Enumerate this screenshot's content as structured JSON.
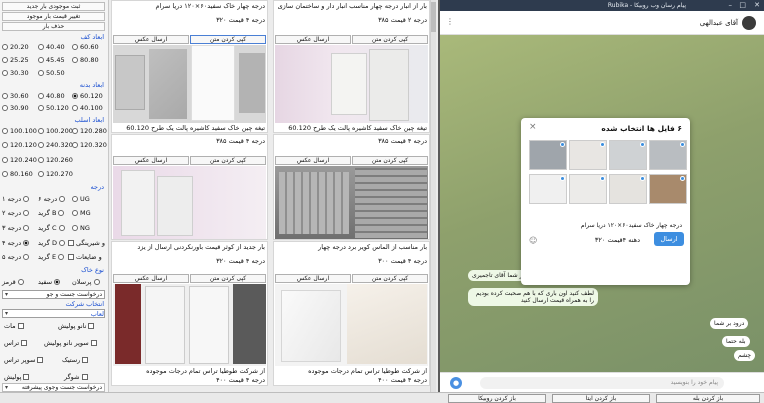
{
  "left_panel": {
    "buttons": [
      "ثبت موجودی بار جدید",
      "تغییر قیمت بار موجود",
      "حذف بار"
    ],
    "sizes_a": [
      [
        "20.20",
        "40.40",
        "60.60"
      ],
      [
        "25.25",
        "45.45",
        "80.80"
      ],
      [
        "30.30",
        "50.50",
        ""
      ]
    ],
    "sec_kaf": "ابعاد کف",
    "sec_badane": "ابعاد بدنه",
    "sizes_b": [
      [
        "30.60",
        "40.80",
        "60.120"
      ],
      [
        "30.90",
        "50.120",
        "40.100"
      ]
    ],
    "sec_aslab": "ابعاد اسلب",
    "sizes_c": [
      [
        "100.100",
        "100.200",
        "120.280"
      ],
      [
        "120.120",
        "240.320",
        "120.320"
      ],
      [
        "120.240",
        "120.260",
        ""
      ],
      [
        "80.160",
        "120.270",
        ""
      ]
    ],
    "sec_daraje": "درجه",
    "grades": [
      [
        "درجه ۱",
        "درجه ۶",
        "UG"
      ],
      [
        "درجه ۲",
        "گرید B",
        "MG"
      ],
      [
        "درجه ۳",
        "گرید C",
        "NG"
      ],
      [
        "درجه ۴",
        "گرید D",
        "و شیرینگی"
      ],
      [
        "درجه ۵",
        "گرید E",
        "و ضایعات"
      ]
    ],
    "sec_khak": "نوع خاک",
    "khak": [
      "قرمز",
      "سفید",
      "پرسلان"
    ],
    "dd1": "درخواست جست و جو",
    "sec_sherkat": "انتخاب شرکت",
    "dd2": "",
    "sec_laab": "لعاب",
    "laab": [
      [
        "مات",
        "نانو پولیش"
      ],
      [
        "تراس",
        "سوپر نانو پولیش"
      ],
      [
        "سوپر تراس",
        "رستیک"
      ],
      [
        "پولیش",
        "شوگر"
      ]
    ],
    "dd3": "درخواست جست وجوی پیشرفته"
  },
  "cards": [
    {
      "title": "بار از انبار درجه چهار مناسب انبار دار و ساختمان سازی",
      "price": "درجه ۲ قیمت ۳۸۵",
      "copy": "کپی کردن متن",
      "send": "ارسال عکس",
      "img": "white-marble"
    },
    {
      "title": "درجه چهار خاک سفید۶۰×۱۲۰ دریا سرام",
      "price": "درجه ۴ قیمت ۳۲۰",
      "copy": "کپی کردن متن",
      "send": "ارسال عکس",
      "img": "grey-tiles"
    },
    {
      "title": "تیغه چین خاک سفید کاشیره پالت یک طرح 60.120",
      "price": "درجه ۴ قیمت ۳۸۵",
      "copy": "کپی کردن متن",
      "send": "ارسال عکس",
      "img": "stacked"
    },
    {
      "title": "تیغه چین خاک سفید کاشیره پالت یک طرح 60.120",
      "price": "درجه ۴ قیمت ۳۸۵",
      "copy": "کپی کردن متن",
      "send": "ارسال عکس",
      "img": "grey-slab"
    },
    {
      "title": "بار مناسب از الماس کویر برد درجه چهار",
      "price": "درجه ۴ قیمت ۳۰۰",
      "copy": "کپی کردن متن",
      "send": "ارسال عکس",
      "img": "boxes"
    },
    {
      "title": "بار جدید از کوثر قیمت باورنکردنی ارسال از یزد",
      "price": "درجه ۴ قیمت ۳۲۰",
      "copy": "کپی کردن متن",
      "send": "ارسال عکس",
      "img": "light-slabs"
    },
    {
      "title": "از شرکت طوطیا تراس تمام درجات موجوده",
      "price": "درجه ۴ قیمت ۴۰۰",
      "copy": "کپی کردن متن",
      "send": "ارسال عکس",
      "img": "marble-veins"
    },
    {
      "title": "از شرکت طوطیا تراس تمام درجات موجوده",
      "price": "درجه ۴ قیمت ۴۰۰",
      "copy": "کپی کردن متن",
      "send": "ارسال عکس",
      "img": "dark-pattern"
    }
  ],
  "messenger": {
    "window_title": "پیام رسان وب روبیکا - Rubika",
    "contact": "آقای عبدالهی",
    "dialog_title": "۶ فایل ها انتخاب شده",
    "caption_line1": "درجه چهار خاک سفید۶۰×۱۲۰ دریا سرام",
    "caption_line2": "دهنه ۴قیمت ۳۲۰",
    "send_label": "ارسال",
    "bubbles": [
      {
        "text": "بر شما آقای تاجمیری",
        "side": "in"
      },
      {
        "text": "لطف کنید اون باری که با هم صحبت کرده بودیم را به همراه قیمت ارسال کنید",
        "side": "in"
      },
      {
        "text": "۱۴:۰۲",
        "side": "in"
      },
      {
        "text": "درود بر شما",
        "side": "out"
      },
      {
        "text": "بله حتما",
        "side": "out"
      },
      {
        "text": "چشم",
        "side": "out"
      }
    ],
    "composer_placeholder": "پیام خود را بنویسید"
  },
  "taskbar": [
    "باز کردن روبیکا",
    "باز کردن ایتا",
    "باز کردن بله"
  ]
}
